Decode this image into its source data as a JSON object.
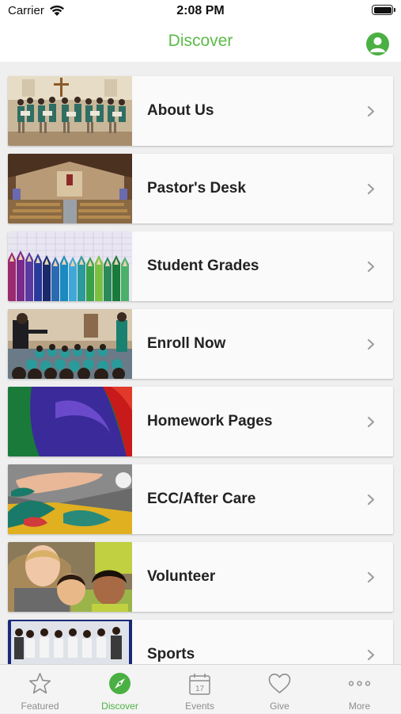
{
  "status": {
    "carrier": "Carrier",
    "time": "2:08 PM"
  },
  "header": {
    "title": "Discover"
  },
  "items": [
    {
      "label": "About Us"
    },
    {
      "label": "Pastor's Desk"
    },
    {
      "label": "Student Grades"
    },
    {
      "label": "Enroll Now"
    },
    {
      "label": "Homework Pages"
    },
    {
      "label": "ECC/After Care"
    },
    {
      "label": "Volunteer"
    },
    {
      "label": "Sports"
    }
  ],
  "tabs": [
    {
      "label": "Featured",
      "icon": "star-icon"
    },
    {
      "label": "Discover",
      "icon": "compass-icon",
      "active": true
    },
    {
      "label": "Events",
      "icon": "calendar-icon"
    },
    {
      "label": "Give",
      "icon": "heart-icon"
    },
    {
      "label": "More",
      "icon": "more-dots-icon"
    }
  ],
  "calendar_day": "17",
  "colors": {
    "accent": "#4bb043",
    "title": "#5cbb48",
    "tab_inactive": "#8d8d8d"
  }
}
